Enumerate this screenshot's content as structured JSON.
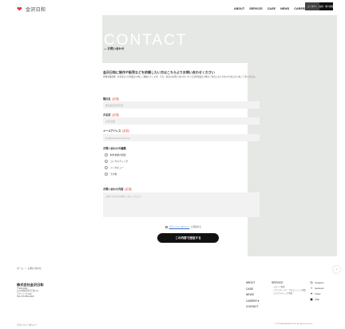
{
  "header": {
    "logo_mark": "❤",
    "logo_text": "金沢日和",
    "nav": [
      "ABOUT",
      "SERVICE",
      "CASE",
      "NEWS",
      "CAREER ▾"
    ],
    "contact_btn": "コンタクト",
    "recruit_btn": "採用・求人情報"
  },
  "hero": {
    "title": "CONTACT",
    "subtitle": "— お問い合わせ"
  },
  "form": {
    "intro_heading": "金沢日和に制作や販売などを依頼したい方はこちらよりお問い合わせください",
    "intro_text": "内容を確認後、担当者より2営業日以内にご連絡いたします。土日・祝日のお問い合わせについては翌営業日以降のご対応となりますのであらかじめご了承ください。",
    "company_label": "御社名",
    "company_req": "[必須]",
    "company_placeholder": "株式会社金沢日和",
    "name_label": "お名前",
    "name_req": "[必須]",
    "name_placeholder": "山田 太郎",
    "email_label": "メールアドレス",
    "email_req": "[必須]",
    "email_placeholder": "info@kanazawa-biyori.jp",
    "type_label": "お問い合わせの種類",
    "type_options": [
      "制作依頼の相談",
      "コンサルティング",
      "インタビュー",
      "その他"
    ],
    "content_label": "お問い合わせ内容",
    "content_req": "[必須]",
    "content_placeholder": "お問い合わせ内容をご記入ください",
    "privacy_link": "プライバシーポリシー",
    "privacy_suffix": "に同意する",
    "submit": "この内容で送信する"
  },
  "breadcrumb": [
    "ホーム",
    ">",
    "お問い合わせ"
  ],
  "footer": {
    "company": "株式会社金沢日和",
    "address": [
      "〒920-0000",
      "石川県金沢市〇〇町1-2",
      "テナントビル2F",
      "TEL 076-000-0000"
    ],
    "nav": [
      "ABOUT",
      "CASE",
      "NEWS",
      "CAREER ▾",
      "CONTACT"
    ],
    "service_title": "SERVICE",
    "service_items": [
      "・メディア事業",
      "・ブランディング・プロモーション事業",
      "・コンサルティング事業"
    ],
    "social": [
      {
        "icon": "instagram-icon",
        "glyph": "◎",
        "label": "Instagram"
      },
      {
        "icon": "facebook-icon",
        "glyph": "f",
        "label": "Facebook"
      },
      {
        "icon": "twitter-icon",
        "glyph": "✦",
        "label": "Twitter"
      },
      {
        "icon": "line-icon",
        "glyph": "▣",
        "label": "LINE"
      }
    ],
    "privacy": "プライバシーポリシー",
    "copyright": "© 2023 KANAZAWA BIYORI. All Rights Reserved."
  },
  "pagetop": "^",
  "colors": {
    "accent": "#d33333",
    "panel": "#e6e8e5",
    "dark": "#111111"
  }
}
